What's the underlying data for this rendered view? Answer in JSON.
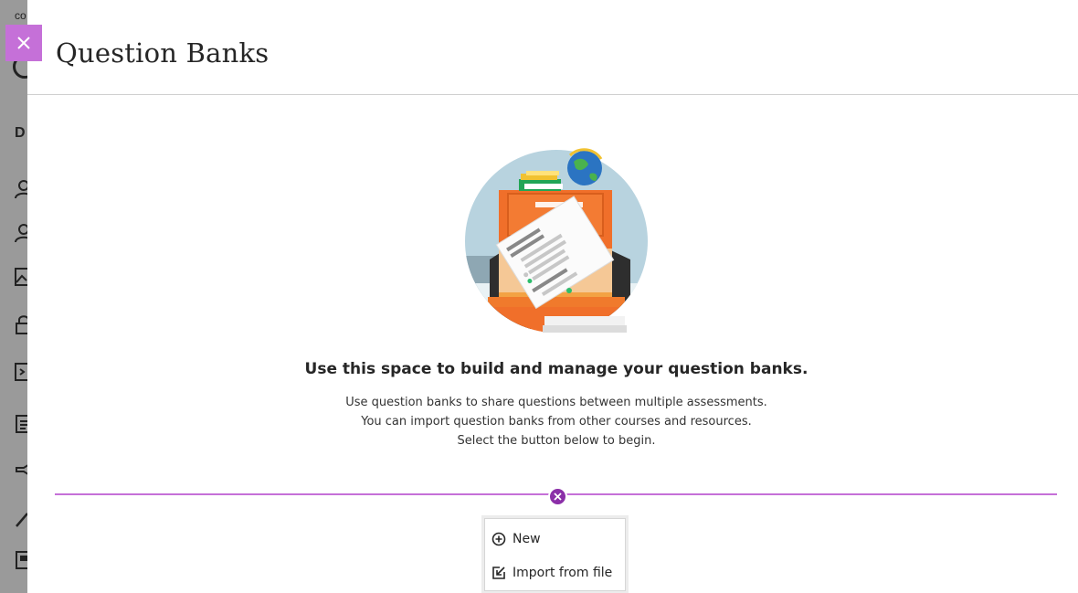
{
  "background": {
    "sidebar_text_top": "co",
    "sidebar_text_d": "D"
  },
  "panel": {
    "title": "Question Banks",
    "close_icon": "close-icon",
    "accent_color": "#c570d8"
  },
  "empty_state": {
    "headline": "Use this space to build and manage your question banks.",
    "lines": [
      "Use question banks to share questions between multiple assessments.",
      "You can import question banks from other courses and resources.",
      "Select the button below to begin."
    ]
  },
  "menu": {
    "items": [
      {
        "label": "New",
        "icon": "plus-circle-icon"
      },
      {
        "label": "Import from file",
        "icon": "import-icon"
      }
    ]
  }
}
